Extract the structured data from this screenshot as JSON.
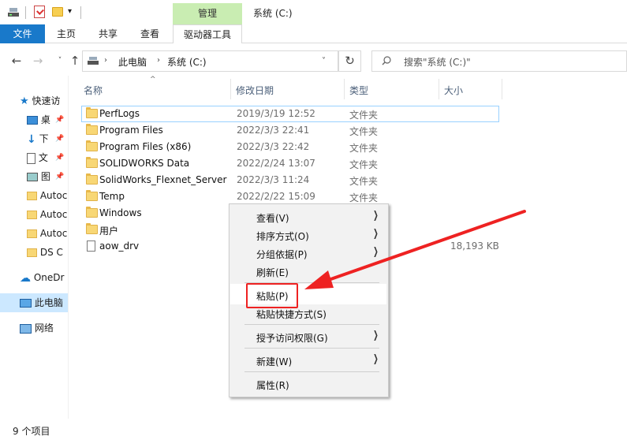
{
  "window": {
    "title": "系统 (C:)",
    "manage_tab": "管理",
    "qa_dropdown": "▾"
  },
  "ribbon": {
    "tabs": [
      "文件",
      "主页",
      "共享",
      "查看",
      "驱动器工具"
    ]
  },
  "nav": {
    "back": "←",
    "forward": "→",
    "recent": "˅",
    "up": "↑",
    "refresh": "↻"
  },
  "address": {
    "this_pc": "此电脑",
    "drive": "系统 (C:)",
    "separator": "›",
    "dropdown": "˅"
  },
  "search": {
    "placeholder": "搜索\"系统 (C:)\""
  },
  "sidebar": {
    "items": [
      {
        "label": "快速访",
        "icon": "star-icon"
      },
      {
        "label": "桌",
        "icon": "desktop-icon",
        "pinned": true
      },
      {
        "label": "下",
        "icon": "download-icon",
        "pinned": true
      },
      {
        "label": "文",
        "icon": "documents-icon",
        "pinned": true
      },
      {
        "label": "图",
        "icon": "pictures-icon",
        "pinned": true
      },
      {
        "label": "Autoc",
        "icon": "folder-icon"
      },
      {
        "label": "Autoc",
        "icon": "folder-icon"
      },
      {
        "label": "Autoc",
        "icon": "folder-icon"
      },
      {
        "label": "DS C",
        "icon": "folder-icon"
      },
      {
        "label": "OneDr",
        "icon": "cloud-icon"
      },
      {
        "label": "此电脑",
        "icon": "computer-icon",
        "selected": true
      },
      {
        "label": "网络",
        "icon": "network-icon"
      }
    ]
  },
  "columns": {
    "name": "名称",
    "date": "修改日期",
    "type": "类型",
    "size": "大小",
    "sort_indicator": "^"
  },
  "files": [
    {
      "name": "PerfLogs",
      "date": "2019/3/19 12:52",
      "type": "文件夹",
      "size": ""
    },
    {
      "name": "Program Files",
      "date": "2022/3/3 22:41",
      "type": "文件夹",
      "size": ""
    },
    {
      "name": "Program Files (x86)",
      "date": "2022/3/3 22:42",
      "type": "文件夹",
      "size": ""
    },
    {
      "name": "SOLIDWORKS Data",
      "date": "2022/2/24 13:07",
      "type": "文件夹",
      "size": ""
    },
    {
      "name": "SolidWorks_Flexnet_Server",
      "date": "2022/3/3 11:24",
      "type": "文件夹",
      "size": ""
    },
    {
      "name": "Temp",
      "date": "2022/2/22 15:09",
      "type": "文件夹",
      "size": ""
    },
    {
      "name": "Windows",
      "date": "",
      "type": "",
      "size": ""
    },
    {
      "name": "用户",
      "date": "",
      "type": "",
      "size": ""
    },
    {
      "name": "aow_drv",
      "date": "",
      "type": "",
      "size": "18,193 KB"
    }
  ],
  "status": {
    "item_count": "9 个项目"
  },
  "context_menu": {
    "items": [
      {
        "label": "查看(V)",
        "submenu": true
      },
      {
        "label": "排序方式(O)",
        "submenu": true
      },
      {
        "label": "分组依据(P)",
        "submenu": true
      },
      {
        "label": "刷新(E)",
        "submenu": false
      },
      {
        "label": "粘贴(P)",
        "submenu": false
      },
      {
        "label": "粘贴快捷方式(S)",
        "submenu": false
      },
      {
        "label": "授予访问权限(G)",
        "submenu": true
      },
      {
        "label": "新建(W)",
        "submenu": true
      },
      {
        "label": "属性(R)",
        "submenu": false
      }
    ],
    "submenu_glyph": "❯"
  },
  "colors": {
    "accent": "#1979ca",
    "manage_tab": "#c9edb2",
    "selection": "#cce8ff",
    "annotation": "#ee2222"
  }
}
